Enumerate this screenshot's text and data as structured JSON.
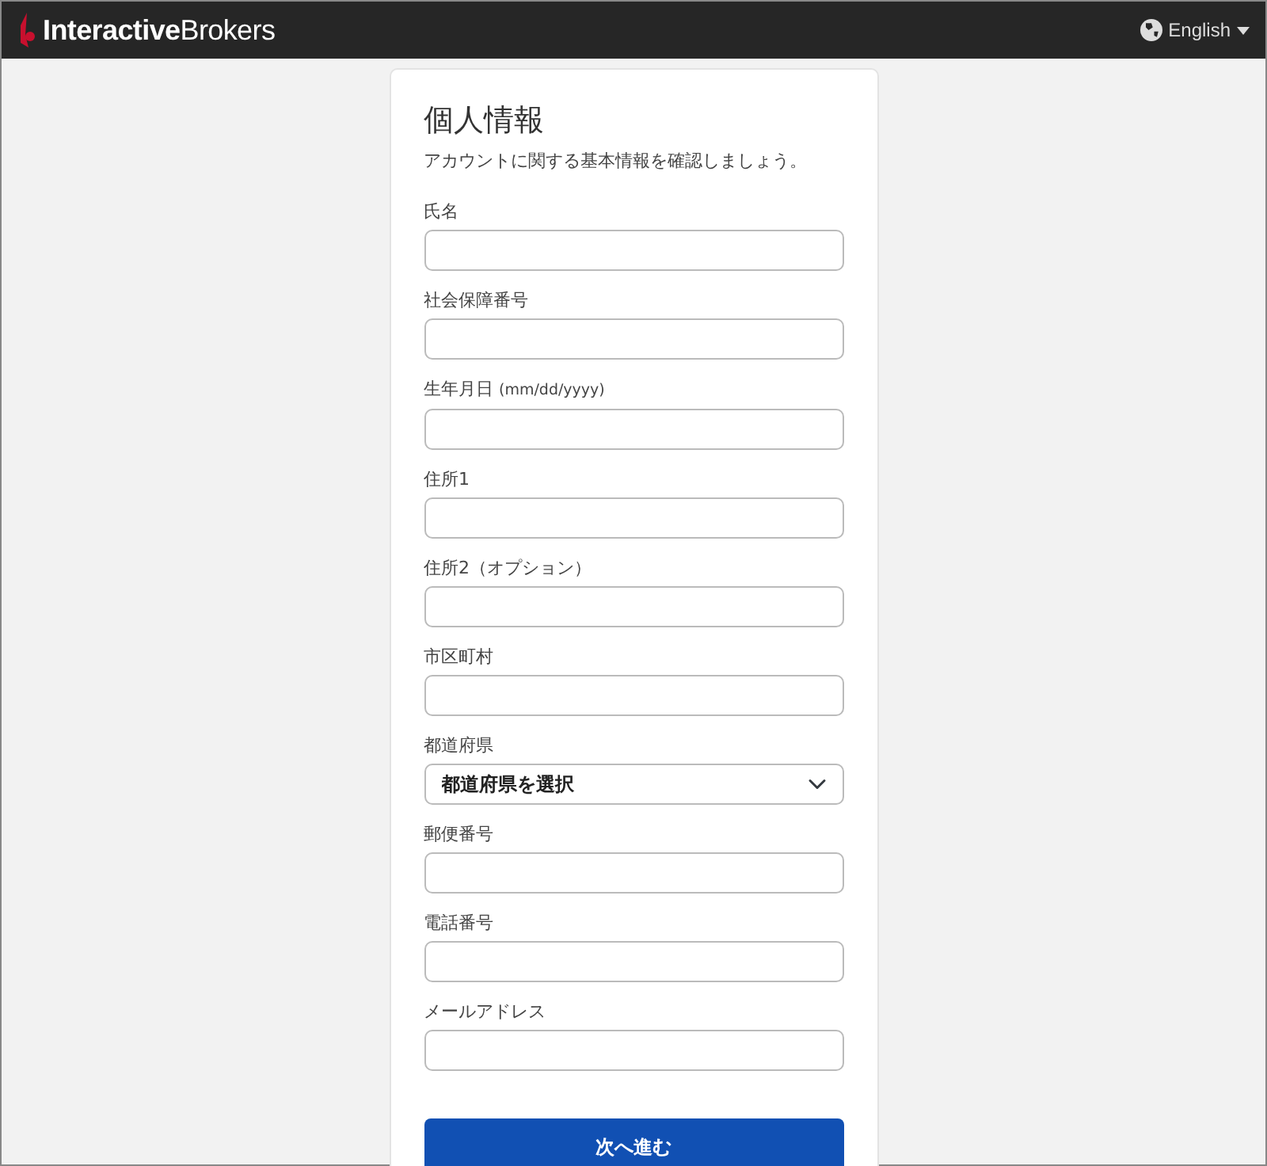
{
  "navbar": {
    "logo": "**Interactive**Brokers",
    "language": "English"
  },
  "form": {
    "title": "個人情報",
    "subtitle": "アカウントに関する基本情報を確認しましょう。",
    "fields": [
      {
        "kind": "text",
        "label": "氏名"
      },
      {
        "kind": "text",
        "label": "社会保障番号"
      },
      {
        "kind": "text",
        "label": "生年月日",
        "hint": "(mm/dd/yyyy)"
      },
      {
        "kind": "text",
        "label": "住所1"
      },
      {
        "kind": "text",
        "label": "住所2（オプション）"
      },
      {
        "kind": "text",
        "label": "市区町村"
      },
      {
        "kind": "select",
        "label": "都道府県",
        "value": "都道府県を選択"
      },
      {
        "kind": "text",
        "label": "郵便番号"
      },
      {
        "kind": "text",
        "label": "電話番号"
      },
      {
        "kind": "text",
        "label": "メールアドレス"
      }
    ],
    "submit": "次へ進む"
  }
}
